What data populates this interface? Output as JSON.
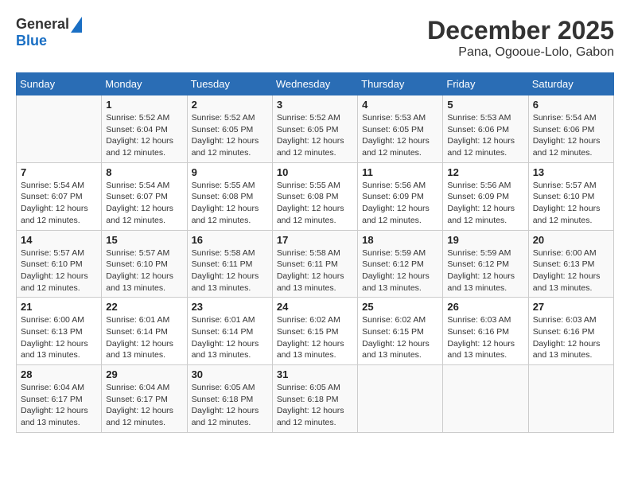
{
  "header": {
    "logo_line1": "General",
    "logo_line2": "Blue",
    "title": "December 2025",
    "subtitle": "Pana, Ogooue-Lolo, Gabon"
  },
  "calendar": {
    "days_of_week": [
      "Sunday",
      "Monday",
      "Tuesday",
      "Wednesday",
      "Thursday",
      "Friday",
      "Saturday"
    ],
    "weeks": [
      [
        {
          "day": "",
          "info": ""
        },
        {
          "day": "1",
          "info": "Sunrise: 5:52 AM\nSunset: 6:04 PM\nDaylight: 12 hours\nand 12 minutes."
        },
        {
          "day": "2",
          "info": "Sunrise: 5:52 AM\nSunset: 6:05 PM\nDaylight: 12 hours\nand 12 minutes."
        },
        {
          "day": "3",
          "info": "Sunrise: 5:52 AM\nSunset: 6:05 PM\nDaylight: 12 hours\nand 12 minutes."
        },
        {
          "day": "4",
          "info": "Sunrise: 5:53 AM\nSunset: 6:05 PM\nDaylight: 12 hours\nand 12 minutes."
        },
        {
          "day": "5",
          "info": "Sunrise: 5:53 AM\nSunset: 6:06 PM\nDaylight: 12 hours\nand 12 minutes."
        },
        {
          "day": "6",
          "info": "Sunrise: 5:54 AM\nSunset: 6:06 PM\nDaylight: 12 hours\nand 12 minutes."
        }
      ],
      [
        {
          "day": "7",
          "info": "Sunrise: 5:54 AM\nSunset: 6:07 PM\nDaylight: 12 hours\nand 12 minutes."
        },
        {
          "day": "8",
          "info": "Sunrise: 5:54 AM\nSunset: 6:07 PM\nDaylight: 12 hours\nand 12 minutes."
        },
        {
          "day": "9",
          "info": "Sunrise: 5:55 AM\nSunset: 6:08 PM\nDaylight: 12 hours\nand 12 minutes."
        },
        {
          "day": "10",
          "info": "Sunrise: 5:55 AM\nSunset: 6:08 PM\nDaylight: 12 hours\nand 12 minutes."
        },
        {
          "day": "11",
          "info": "Sunrise: 5:56 AM\nSunset: 6:09 PM\nDaylight: 12 hours\nand 12 minutes."
        },
        {
          "day": "12",
          "info": "Sunrise: 5:56 AM\nSunset: 6:09 PM\nDaylight: 12 hours\nand 12 minutes."
        },
        {
          "day": "13",
          "info": "Sunrise: 5:57 AM\nSunset: 6:10 PM\nDaylight: 12 hours\nand 12 minutes."
        }
      ],
      [
        {
          "day": "14",
          "info": "Sunrise: 5:57 AM\nSunset: 6:10 PM\nDaylight: 12 hours\nand 12 minutes."
        },
        {
          "day": "15",
          "info": "Sunrise: 5:57 AM\nSunset: 6:10 PM\nDaylight: 12 hours\nand 13 minutes."
        },
        {
          "day": "16",
          "info": "Sunrise: 5:58 AM\nSunset: 6:11 PM\nDaylight: 12 hours\nand 13 minutes."
        },
        {
          "day": "17",
          "info": "Sunrise: 5:58 AM\nSunset: 6:11 PM\nDaylight: 12 hours\nand 13 minutes."
        },
        {
          "day": "18",
          "info": "Sunrise: 5:59 AM\nSunset: 6:12 PM\nDaylight: 12 hours\nand 13 minutes."
        },
        {
          "day": "19",
          "info": "Sunrise: 5:59 AM\nSunset: 6:12 PM\nDaylight: 12 hours\nand 13 minutes."
        },
        {
          "day": "20",
          "info": "Sunrise: 6:00 AM\nSunset: 6:13 PM\nDaylight: 12 hours\nand 13 minutes."
        }
      ],
      [
        {
          "day": "21",
          "info": "Sunrise: 6:00 AM\nSunset: 6:13 PM\nDaylight: 12 hours\nand 13 minutes."
        },
        {
          "day": "22",
          "info": "Sunrise: 6:01 AM\nSunset: 6:14 PM\nDaylight: 12 hours\nand 13 minutes."
        },
        {
          "day": "23",
          "info": "Sunrise: 6:01 AM\nSunset: 6:14 PM\nDaylight: 12 hours\nand 13 minutes."
        },
        {
          "day": "24",
          "info": "Sunrise: 6:02 AM\nSunset: 6:15 PM\nDaylight: 12 hours\nand 13 minutes."
        },
        {
          "day": "25",
          "info": "Sunrise: 6:02 AM\nSunset: 6:15 PM\nDaylight: 12 hours\nand 13 minutes."
        },
        {
          "day": "26",
          "info": "Sunrise: 6:03 AM\nSunset: 6:16 PM\nDaylight: 12 hours\nand 13 minutes."
        },
        {
          "day": "27",
          "info": "Sunrise: 6:03 AM\nSunset: 6:16 PM\nDaylight: 12 hours\nand 13 minutes."
        }
      ],
      [
        {
          "day": "28",
          "info": "Sunrise: 6:04 AM\nSunset: 6:17 PM\nDaylight: 12 hours\nand 13 minutes."
        },
        {
          "day": "29",
          "info": "Sunrise: 6:04 AM\nSunset: 6:17 PM\nDaylight: 12 hours\nand 12 minutes."
        },
        {
          "day": "30",
          "info": "Sunrise: 6:05 AM\nSunset: 6:18 PM\nDaylight: 12 hours\nand 12 minutes."
        },
        {
          "day": "31",
          "info": "Sunrise: 6:05 AM\nSunset: 6:18 PM\nDaylight: 12 hours\nand 12 minutes."
        },
        {
          "day": "",
          "info": ""
        },
        {
          "day": "",
          "info": ""
        },
        {
          "day": "",
          "info": ""
        }
      ]
    ]
  }
}
